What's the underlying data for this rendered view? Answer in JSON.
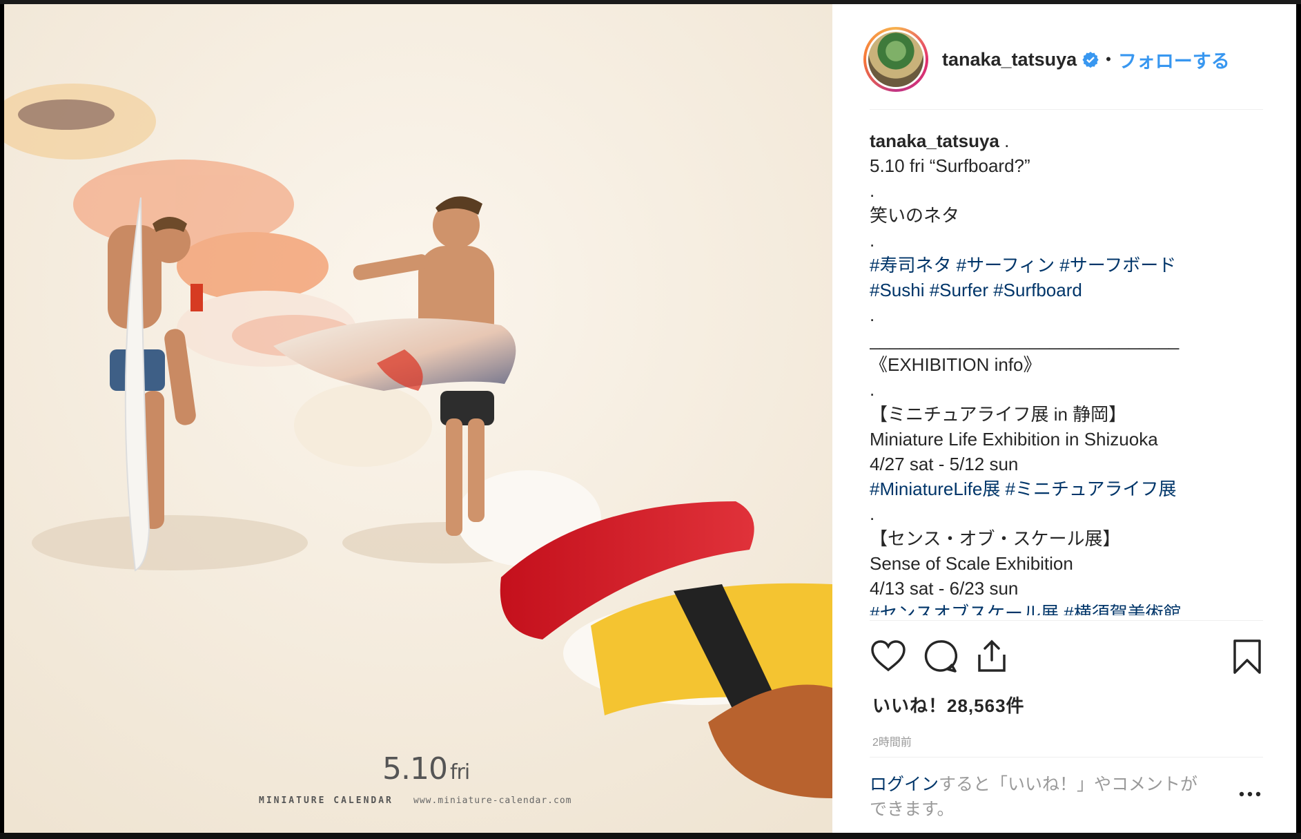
{
  "photo": {
    "calendar_date": "5.10",
    "calendar_dow": "fri",
    "calendar_brand": "MINIATURE CALENDAR",
    "calendar_url": "www.miniature-calendar.com"
  },
  "header": {
    "username": "tanaka_tatsuya",
    "separator": "•",
    "follow_label": "フォローする",
    "avatar_icon": "profile-avatar",
    "verified_icon": "verified-badge-icon",
    "accent_color": "#3897f0"
  },
  "caption": {
    "username": "tanaka_tatsuya",
    "first_text": " .",
    "lines": [
      {
        "text": "5.10 fri “Surfboard?”",
        "kind": "text"
      },
      {
        "text": ".",
        "kind": "text"
      },
      {
        "text": "笑いのネタ",
        "kind": "text"
      },
      {
        "text": ".",
        "kind": "text"
      },
      {
        "text": "#寿司ネタ #サーフィン #サーフボード",
        "kind": "tag"
      },
      {
        "text": "#Sushi #Surfer #Surfboard",
        "kind": "tag"
      },
      {
        "text": ".",
        "kind": "text"
      },
      {
        "text": "_______________________________",
        "kind": "text"
      },
      {
        "text": "《EXHIBITION info》",
        "kind": "text"
      },
      {
        "text": ".",
        "kind": "text"
      },
      {
        "text": "【ミニチュアライフ展 in 静岡】",
        "kind": "text"
      },
      {
        "text": "Miniature Life Exhibition in Shizuoka",
        "kind": "text"
      },
      {
        "text": "4/27 sat - 5/12 sun",
        "kind": "text"
      },
      {
        "text": "#MiniatureLife展 #ミニチュアライフ展",
        "kind": "tag"
      },
      {
        "text": ".",
        "kind": "text"
      },
      {
        "text": "【センス・オブ・スケール展】",
        "kind": "text"
      },
      {
        "text": "Sense of Scale Exhibition",
        "kind": "text"
      },
      {
        "text": "4/13 sat - 6/23 sun",
        "kind": "text"
      },
      {
        "text": "#センスオブスケール展 #横須賀美術館",
        "kind": "tag"
      }
    ],
    "link_color": "#003569"
  },
  "actions": {
    "like_icon": "heart-icon",
    "comment_icon": "comment-icon",
    "share_icon": "share-icon",
    "save_icon": "bookmark-icon"
  },
  "likes": "いいね！28,563件",
  "time_ago": "2時間前",
  "login": {
    "link_text": "ログイン",
    "rest_text": "すると「いいね！」やコメントができます。"
  },
  "more_icon": "more-options-icon"
}
